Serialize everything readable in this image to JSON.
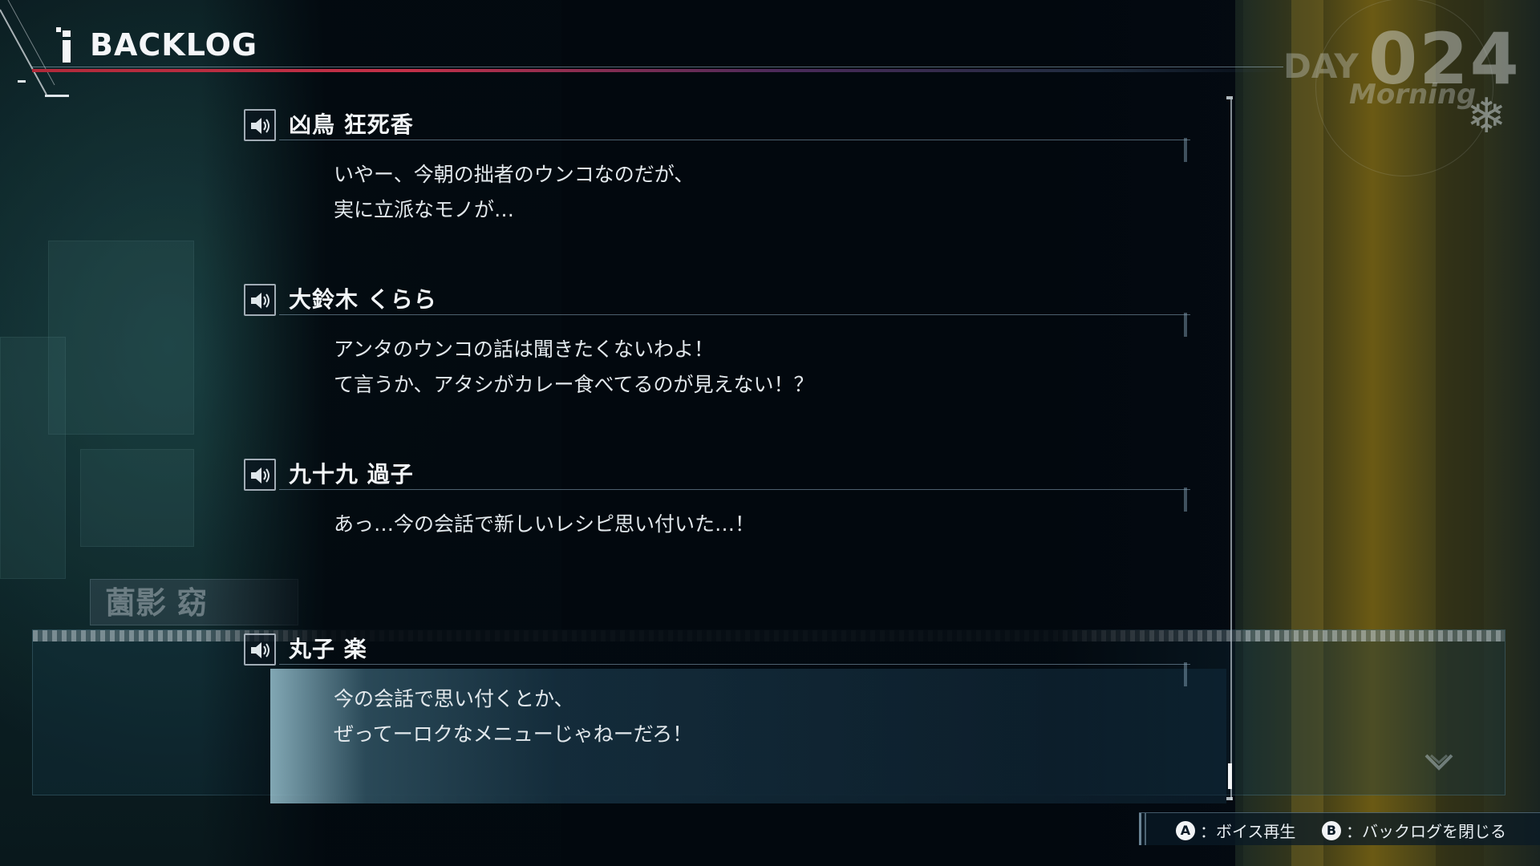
{
  "header": {
    "title": "BACKLOG"
  },
  "day": {
    "label": "DAY",
    "number": "024",
    "time_of_day": "Morning"
  },
  "background": {
    "nameplate": "薗影 窈"
  },
  "entries": [
    {
      "speaker": "凶鳥 狂死香",
      "lines": [
        "いやー、今朝の拙者のウンコなのだが、",
        "実に立派なモノが…"
      ]
    },
    {
      "speaker": "大鈴木 くらら",
      "lines": [
        "アンタのウンコの話は聞きたくないわよ！",
        "て言うか、アタシがカレー食べてるのが見えない！？"
      ]
    },
    {
      "speaker": "九十九 過子",
      "lines": [
        "あっ…今の会話で新しいレシピ思い付いた…！"
      ]
    },
    {
      "speaker": "丸子 楽",
      "lines": [
        "今の会話で思い付くとか、",
        "ぜってーロクなメニューじゃねーだろ！"
      ]
    }
  ],
  "footer": {
    "hints": [
      {
        "button": "A",
        "label": "：ボイス再生"
      },
      {
        "button": "B",
        "label": "：バックログを閉じる"
      }
    ]
  },
  "colors": {
    "accent_red": "#c23048",
    "background": "#040a12",
    "highlight": "#5a96af"
  },
  "icons": {
    "voice": "speaker-icon",
    "scroll_more": "chevron-down-icon"
  }
}
